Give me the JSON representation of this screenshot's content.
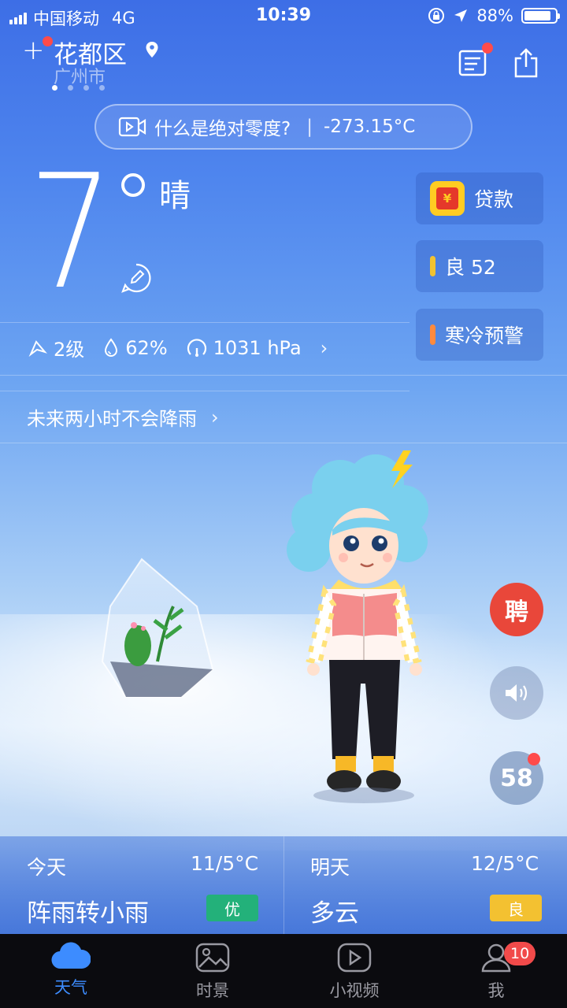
{
  "status_bar": {
    "carrier": "中国移动",
    "network": "4G",
    "time": "10:39",
    "battery_pct": "88%"
  },
  "header": {
    "add_symbol": "+",
    "district": "花都区",
    "city": "广州市",
    "page_count": 4,
    "active_page": 1
  },
  "topic": {
    "text": "什么是绝对零度?",
    "value": "-273.15°C"
  },
  "current": {
    "temperature": "7",
    "condition": "晴"
  },
  "cards": {
    "loan_label": "贷款",
    "loan_icon_glyph": "¥",
    "aqi_label": "良 52",
    "aqi_color": "#f2c230",
    "warning_label": "寒冷预警",
    "warning_color": "#ff8a3d"
  },
  "metrics": {
    "wind": "2级",
    "humidity": "62%",
    "pressure": "1031 hPa",
    "chevron": "›"
  },
  "rain_forecast": {
    "text": "未来两小时不会降雨",
    "chevron": "›"
  },
  "floating": {
    "hire_label": "聘",
    "badge_58": "58"
  },
  "forecast": {
    "today": {
      "label": "今天",
      "temp": "11/5°C",
      "condition": "阵雨转小雨",
      "aqi": "优",
      "aqi_color": "#23b17a"
    },
    "tomorrow": {
      "label": "明天",
      "temp": "12/5°C",
      "condition": "多云",
      "aqi": "良",
      "aqi_color": "#f3c131"
    }
  },
  "tabs": [
    {
      "label": "天气",
      "icon": "cloud-icon",
      "active": true
    },
    {
      "label": "时景",
      "icon": "picture-icon",
      "active": false
    },
    {
      "label": "小视频",
      "icon": "play-icon",
      "active": false
    },
    {
      "label": "我",
      "icon": "user-icon",
      "active": false
    }
  ],
  "me_badge": "10"
}
